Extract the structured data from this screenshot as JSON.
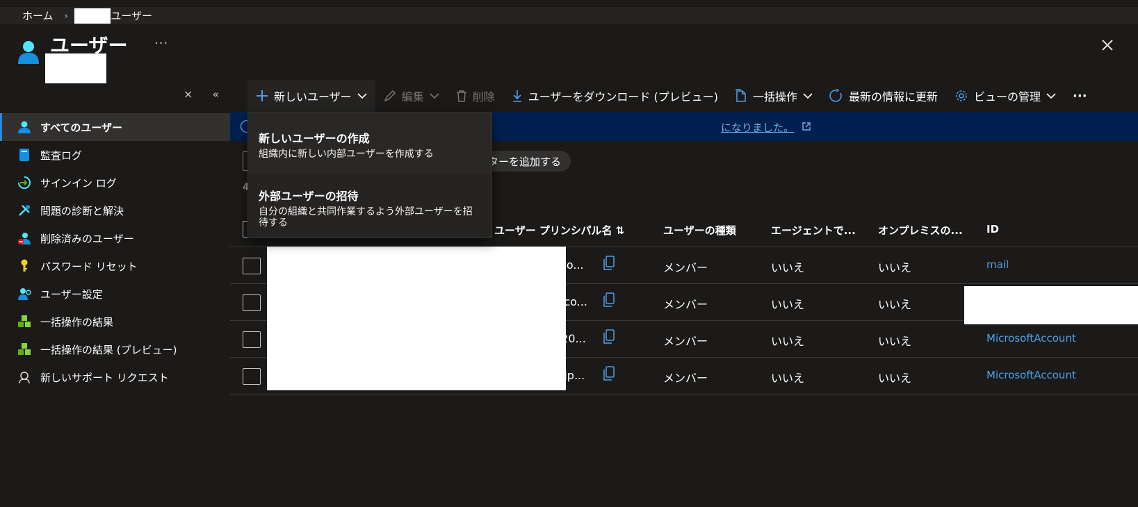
{
  "breadcrumb": {
    "home": "ホーム",
    "current": "ユーザー"
  },
  "header": {
    "title": "ユーザー",
    "more": "···"
  },
  "toolbar": {
    "new_user": "新しいユーザー",
    "edit": "編集",
    "delete": "削除",
    "download": "ユーザーをダウンロード (プレビュー)",
    "bulk": "一括操作",
    "refresh": "最新の情報に更新",
    "manage_view": "ビューの管理",
    "more": "···"
  },
  "sidebar": {
    "items": [
      {
        "label": "すべてのユーザー",
        "icon": "user-icon"
      },
      {
        "label": "監査ログ",
        "icon": "book-icon"
      },
      {
        "label": "サインイン ログ",
        "icon": "signin-icon"
      },
      {
        "label": "問題の診断と解決",
        "icon": "tools-icon"
      },
      {
        "label": "削除済みのユーザー",
        "icon": "user-deleted-icon"
      },
      {
        "label": "パスワード リセット",
        "icon": "key-icon"
      },
      {
        "label": "ユーザー設定",
        "icon": "user-settings-icon"
      },
      {
        "label": "一括操作の結果",
        "icon": "cubes-icon"
      },
      {
        "label": "一括操作の結果 (プレビュー)",
        "icon": "cubes-icon"
      },
      {
        "label": "新しいサポート リクエスト",
        "icon": "support-icon"
      }
    ]
  },
  "banner": {
    "link_text": "になりました。"
  },
  "filter": {
    "add_filter": "ターを追加する"
  },
  "count_text": "4",
  "dropdown": {
    "items": [
      {
        "title": "新しいユーザーの作成",
        "desc": "組織内に新しい内部ユーザーを作成する"
      },
      {
        "title": "外部ユーザーの招待",
        "desc": "自分の組織と共同作業するよう外部ユーザーを招待する"
      }
    ]
  },
  "table": {
    "headers": {
      "upn": "ユーザー プリンシパル名",
      "sort": "⇅",
      "type": "ユーザーの種類",
      "agent": "エージェントで...",
      "onprem": "オンプレミスの...",
      "id": "ID"
    },
    "rows": [
      {
        "upn": "i.so...",
        "type": "メンバー",
        "agent": "いいえ",
        "onprem": "いいえ",
        "id": "mail"
      },
      {
        "upn": "k.co...",
        "type": "メンバー",
        "agent": "いいえ",
        "onprem": "いいえ",
        "id": ""
      },
      {
        "upn": "120...",
        "type": "メンバー",
        "agent": "いいえ",
        "onprem": "いいえ",
        "id": "MicrosoftAccount"
      },
      {
        "upn": "k.jp...",
        "type": "メンバー",
        "agent": "いいえ",
        "onprem": "いいえ",
        "id": "MicrosoftAccount"
      }
    ]
  },
  "colors": {
    "background": "#1b1a19",
    "accent": "#2b88d8",
    "banner": "#002050",
    "link": "#4f9fe8"
  }
}
